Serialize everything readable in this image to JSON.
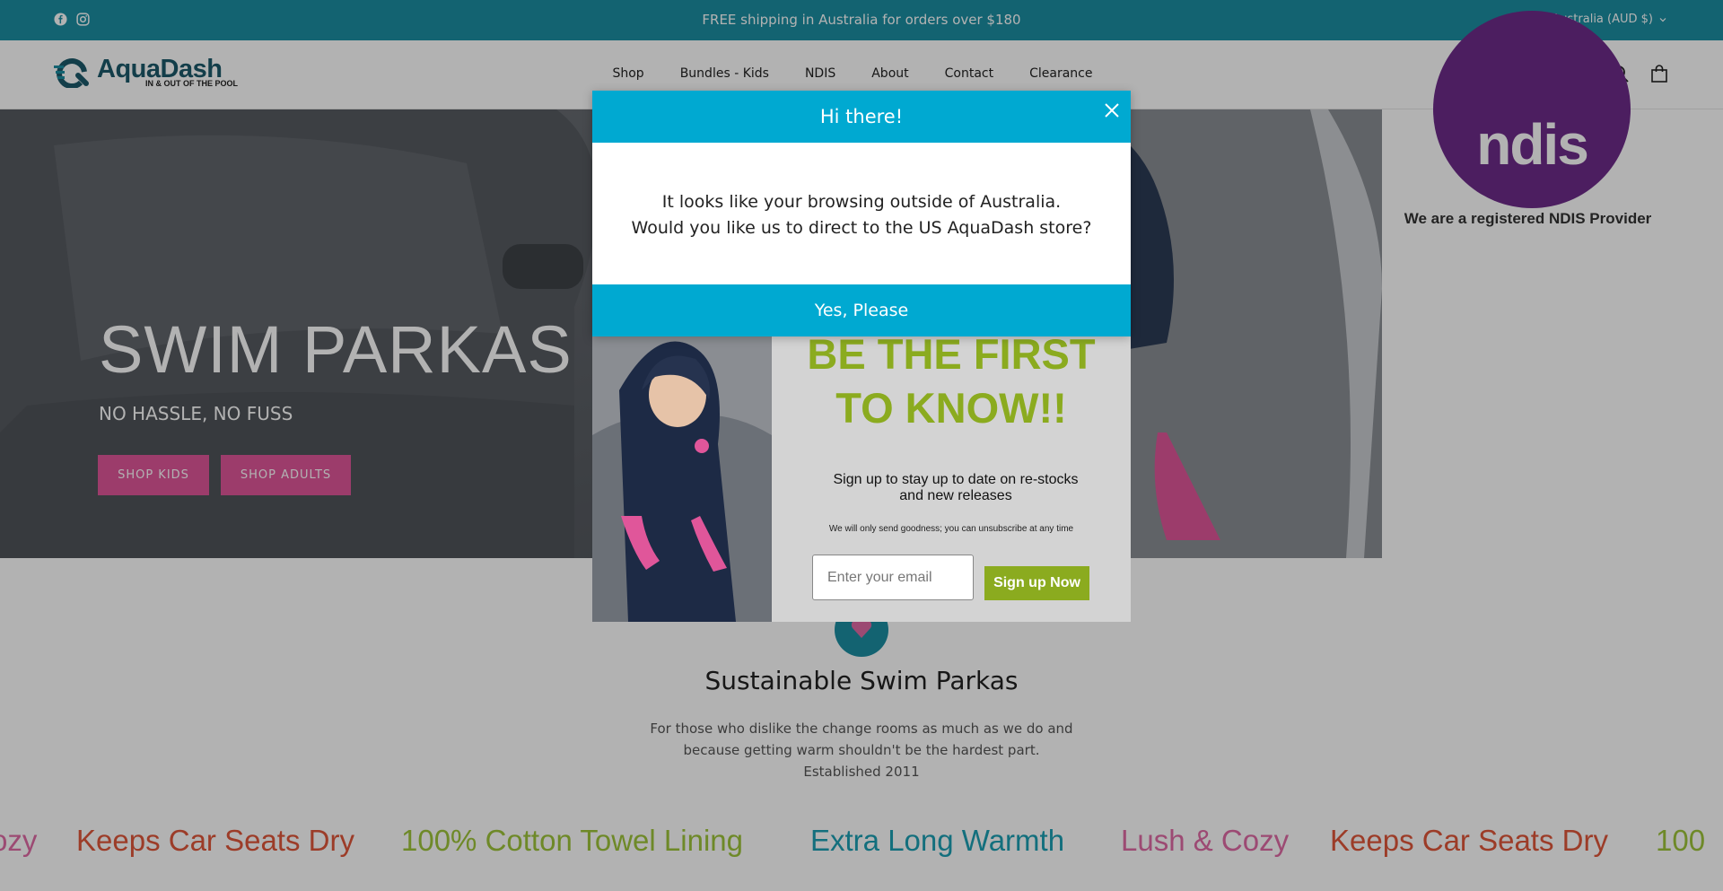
{
  "announcement": {
    "message": "FREE shipping in Australia for orders over $180",
    "locale": "Australia (AUD $)",
    "social_icons": [
      "facebook-icon",
      "instagram-icon"
    ]
  },
  "header": {
    "logo": {
      "brand": "AquaDash",
      "tagline": "IN & OUT OF THE POOL"
    },
    "nav": [
      "Shop",
      "Bundles - Kids",
      "NDIS",
      "About",
      "Contact",
      "Clearance"
    ],
    "icons": [
      "account-icon",
      "search-icon",
      "cart-icon"
    ]
  },
  "hero": {
    "title": "SWIM PARKAS",
    "subtitle": "NO HASSLE, NO FUSS",
    "buttons": [
      "SHOP KIDS",
      "SHOP ADULTS"
    ]
  },
  "ndis": {
    "logo_text": "ndis",
    "caption": "We are a registered NDIS Provider"
  },
  "section": {
    "title": "Sustainable Swim Parkas",
    "body_line1": "For those who dislike the change rooms as much as we do and",
    "body_line2": "because getting warm shouldn't be the hardest part.",
    "body_line3": "Established 2011"
  },
  "marquee": {
    "items": [
      "ozy",
      "Keeps Car Seats Dry",
      "100% Cotton Towel Lining",
      "Extra Long Warmth",
      "Lush & Cozy",
      "Keeps Car Seats Dry",
      "100"
    ]
  },
  "geo_popup": {
    "title": "Hi there!",
    "line1": "It looks like your browsing outside of Australia.",
    "line2": "Would you like us to direct to the US AquaDash store?",
    "confirm": "Yes, Please"
  },
  "signup_popup": {
    "headline1": "BE THE FIRST",
    "headline2": "TO KNOW!!",
    "description": "Sign up to stay up to date on re-stocks and new releases",
    "fine_print": "We will only send goodness; you can unsubscribe at any time",
    "email_placeholder": "Enter your email",
    "submit": "Sign up Now"
  },
  "colors": {
    "teal": "#1c8fa3",
    "popup_blue": "#00a9d1",
    "pink": "#e0569a",
    "green": "#8bab1f",
    "marquee_orange": "#e0573a",
    "marquee_green": "#9ec43a",
    "marquee_teal": "#1c9fb4",
    "marquee_pink": "#e06aa5"
  }
}
